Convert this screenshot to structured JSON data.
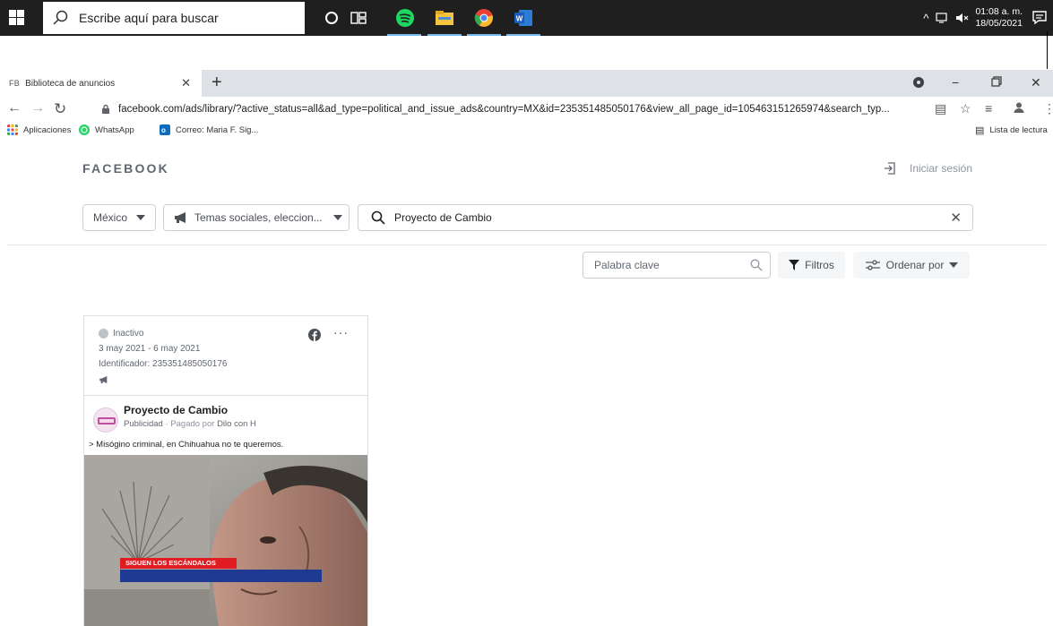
{
  "taskbar": {
    "search_placeholder": "Escribe aquí para buscar",
    "clock_time": "01:08 a. m.",
    "clock_date": "18/05/2021",
    "tray_caret": "^",
    "apps": [
      "task-view-icon",
      "spotify-icon",
      "file-explorer-icon",
      "chrome-icon",
      "word-icon"
    ]
  },
  "browser": {
    "tab_favicon": "FB",
    "tab_title": "Biblioteca de anuncios",
    "url": "facebook.com/ads/library/?active_status=all&ad_type=political_and_issue_ads&country=MX&id=235351485050176&view_all_page_id=105463151265974&search_typ...",
    "bookmarks": [
      "Aplicaciones",
      "WhatsApp",
      "Correo: Maria F. Sig..."
    ],
    "reading_list": "Lista de lectura"
  },
  "page": {
    "logo": "FACEBOOK",
    "login": "Iniciar sesión",
    "country": "México",
    "category": "Temas sociales, eleccion...",
    "search_value": "Proyecto de Cambio",
    "keyword_placeholder": "Palabra clave",
    "filters": "Filtros",
    "sort": "Ordenar por"
  },
  "ad": {
    "status": "Inactivo",
    "dates": "3 may 2021 - 6 may 2021",
    "identifier": "Identificador: 235351485050176",
    "page_name": "Proyecto de Cambio",
    "sponsored": "Publicidad",
    "paid_by_prefix": "· Pagado por",
    "paid_by": "Dilo con H",
    "body": "> Misógino criminal, en Chihuahua no te queremos.",
    "banner": "SIGUEN LOS ESCÁNDALOS"
  },
  "colors": {
    "taskbar": "#1f1f1f",
    "tabstrip": "#dee1e6",
    "border": "#ccd0d5",
    "banner_red": "#e11b22",
    "banner_blue": "#1f3a93"
  }
}
